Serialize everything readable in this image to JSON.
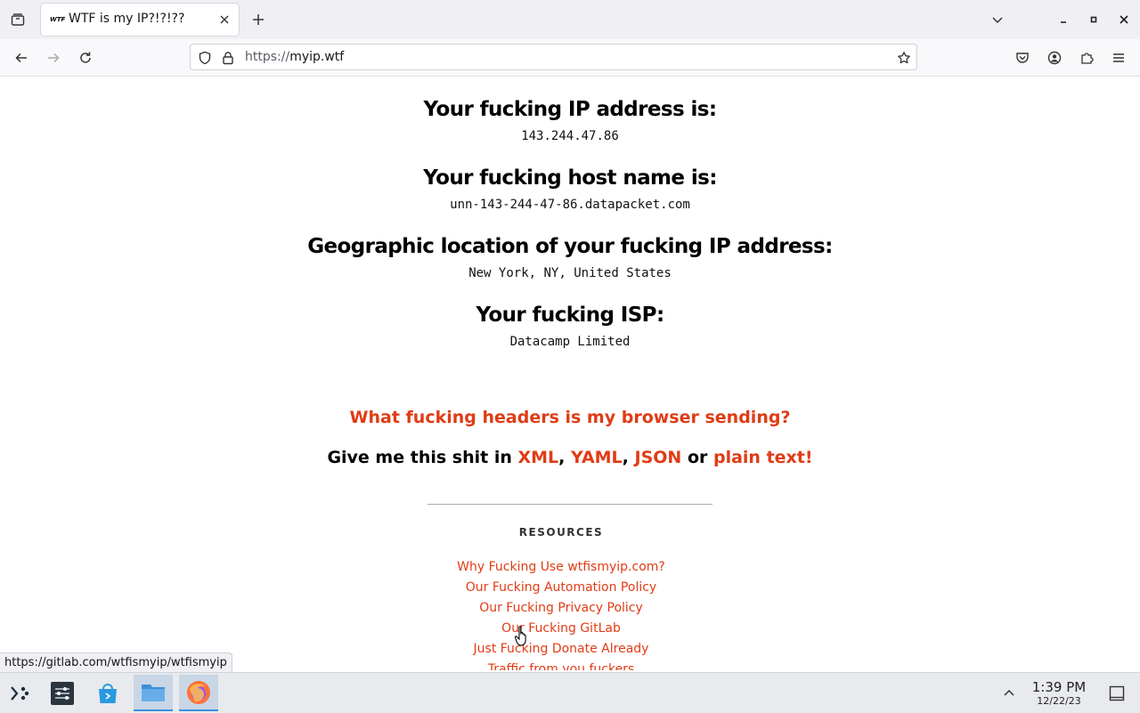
{
  "browser": {
    "tab": {
      "favicon_text": "WTF",
      "title": "WTF is my IP?!?!??"
    },
    "url": {
      "prefix": "https://",
      "domain": "myip.wtf"
    },
    "status_url": "https://gitlab.com/wtfismyip/wtfismyip"
  },
  "page": {
    "ip_heading": "Your fucking IP address is:",
    "ip_value": "143.244.47.86",
    "host_heading": "Your fucking host name is:",
    "host_value": "unn-143-244-47-86.datapacket.com",
    "geo_heading": "Geographic location of your fucking IP address:",
    "geo_value": "New York, NY, United States",
    "isp_heading": "Your fucking ISP:",
    "isp_value": "Datacamp Limited",
    "headers_link": "What fucking headers is my browser sending?",
    "formats": {
      "prefix": "Give me this shit in ",
      "xml": "XML",
      "sep1": ", ",
      "yaml": "YAML",
      "sep2": ", ",
      "json": "JSON",
      "or": " or ",
      "plain": "plain text!"
    },
    "resources_title": "RESOURCES",
    "resources": [
      "Why Fucking Use wtfismyip.com?",
      "Our Fucking Automation Policy",
      "Our Fucking Privacy Policy",
      "Our Fucking GitLab",
      "Just Fucking Donate Already",
      "Traffic from you fuckers"
    ]
  },
  "taskbar": {
    "time": "1:39 PM",
    "date": "12/22/23"
  },
  "colors": {
    "link": "#e03c15",
    "active_task": "#3d8ee0"
  }
}
